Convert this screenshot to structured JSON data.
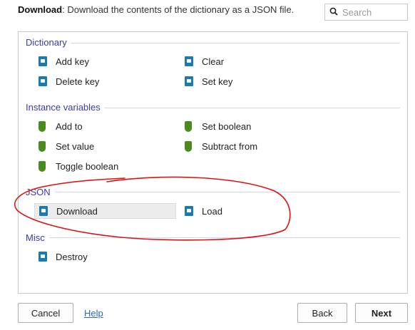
{
  "header": {
    "title_bold": "Download",
    "description": ": Download the contents of the dictionary as a JSON file."
  },
  "search": {
    "placeholder": "Search",
    "icon": "search-icon"
  },
  "sections": [
    {
      "title": "Dictionary",
      "items": [
        {
          "label": "Add key",
          "icon": "document-icon"
        },
        {
          "label": "Clear",
          "icon": "document-icon"
        },
        {
          "label": "Delete key",
          "icon": "document-icon"
        },
        {
          "label": "Set key",
          "icon": "document-icon"
        }
      ]
    },
    {
      "title": "Instance variables",
      "items": [
        {
          "label": "Add to",
          "icon": "shield-icon"
        },
        {
          "label": "Set boolean",
          "icon": "shield-icon"
        },
        {
          "label": "Set value",
          "icon": "shield-icon"
        },
        {
          "label": "Subtract from",
          "icon": "shield-icon"
        },
        {
          "label": "Toggle boolean",
          "icon": "shield-icon"
        }
      ]
    },
    {
      "title": "JSON",
      "items": [
        {
          "label": "Download",
          "icon": "document-icon",
          "selected": true
        },
        {
          "label": "Load",
          "icon": "document-icon"
        }
      ]
    },
    {
      "title": "Misc",
      "items": [
        {
          "label": "Destroy",
          "icon": "document-icon"
        }
      ]
    }
  ],
  "annotation": {
    "color": "#e01010"
  },
  "colors": {
    "section_title": "#3a3aa8",
    "doc_icon": "#1a7bb0",
    "shield_icon": "#4a8a1e",
    "link": "#2e63c8"
  },
  "footer": {
    "cancel": "Cancel",
    "help": "Help",
    "back": "Back",
    "next": "Next"
  }
}
